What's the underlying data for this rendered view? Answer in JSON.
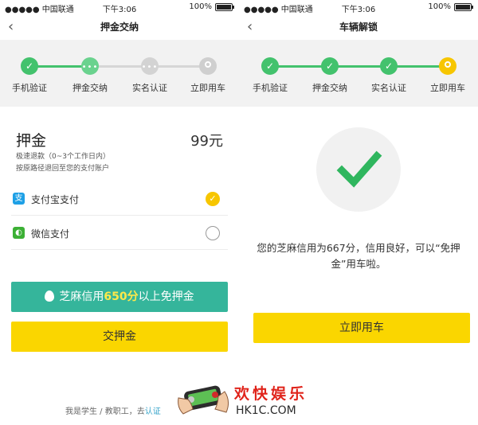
{
  "left": {
    "status": {
      "carrier": "●●●●● 中国联通",
      "time": "下午3:06",
      "battery": "100%"
    },
    "nav": {
      "title": "押金交纳",
      "back_icon": "chevron-left-icon"
    },
    "steps": [
      {
        "label": "手机验证",
        "state": "done"
      },
      {
        "label": "押金交纳",
        "state": "current"
      },
      {
        "label": "实名认证",
        "state": "todo"
      },
      {
        "label": "立即用车",
        "state": "todo"
      }
    ],
    "deposit": {
      "title": "押金",
      "amount": "99元",
      "note1": "极速退款（0~3个工作日内）",
      "note2": "按原路径退回至您的支付账户"
    },
    "payments": [
      {
        "label": "支付宝支付",
        "icon": "alipay-icon",
        "icon_glyph": "支",
        "selected": true
      },
      {
        "label": "微信支付",
        "icon": "wechat-icon",
        "icon_glyph": "◐",
        "selected": false
      }
    ],
    "credit_button": {
      "prefix": "芝麻信用",
      "score": "650分",
      "suffix": "以上免押金"
    },
    "pay_button": "交押金",
    "footer": {
      "text": "我是学生 / 教职工，去",
      "link": "认证"
    },
    "watermark": {
      "title": "欢快娱乐",
      "url": "HK1C.COM"
    }
  },
  "right": {
    "status": {
      "carrier": "●●●●● 中国联通",
      "time": "下午3:06",
      "battery": "100%"
    },
    "nav": {
      "title": "车辆解锁",
      "back_icon": "chevron-left-icon"
    },
    "steps": [
      {
        "label": "手机验证",
        "state": "done"
      },
      {
        "label": "押金交纳",
        "state": "done"
      },
      {
        "label": "实名认证",
        "state": "done"
      },
      {
        "label": "立即用车",
        "state": "target"
      }
    ],
    "message": "您的芝麻信用为667分，信用良好，可以“免押金”用车啦。",
    "use_button": "立即用车"
  },
  "colors": {
    "green": "#43c26d",
    "teal": "#35b59b",
    "yellow": "#fad600",
    "step_bg": "#f2f2f2"
  }
}
